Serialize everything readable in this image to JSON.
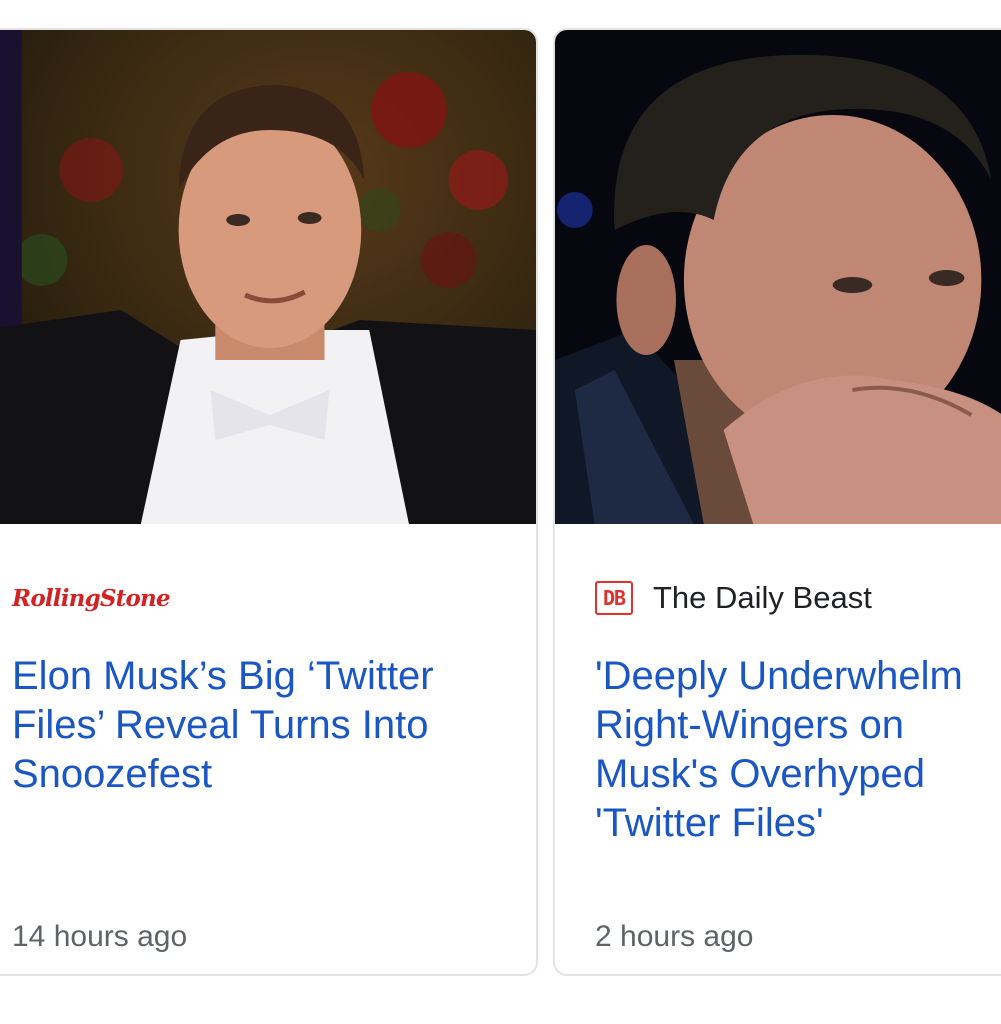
{
  "cards": [
    {
      "source": "RollingStone",
      "headline": "Elon Musk’s Big ‘Twitter Files’ Reveal Turns Into Snoozefest",
      "time": "14 hours ago",
      "image_alt": "Elon Musk in a tuxedo and white bow tie"
    },
    {
      "source_logo": "DB",
      "source": "The Daily Beast",
      "headline_lines": [
        "'Deeply Underwhelm",
        "Right-Wingers on",
        "Musk's Overhyped",
        "'Twitter Files'"
      ],
      "time": "2 hours ago",
      "image_alt": "Elon Musk resting chin on hand"
    }
  ],
  "colors": {
    "headline": "#1a56c4",
    "rolling_stone": "#d32222",
    "daily_beast": "#e0312e",
    "timestamp": "#5f6368"
  }
}
